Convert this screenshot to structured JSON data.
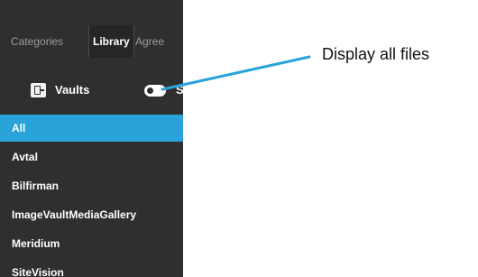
{
  "tabs": [
    {
      "label": "Categories",
      "active": false
    },
    {
      "label": "Library",
      "active": true
    },
    {
      "label": "Agree",
      "active": false
    }
  ],
  "vaults": {
    "label": "Vaults",
    "toggle_label": "S"
  },
  "library_items": [
    {
      "label": "All",
      "selected": true
    },
    {
      "label": "Avtal",
      "selected": false
    },
    {
      "label": "Bilfirman",
      "selected": false
    },
    {
      "label": "ImageVaultMediaGallery",
      "selected": false
    },
    {
      "label": "Meridium",
      "selected": false
    },
    {
      "label": "SiteVision",
      "selected": false
    }
  ],
  "callout": {
    "text": "Display all files"
  },
  "colors": {
    "panel_bg": "#2f2f30",
    "selected_bg": "#29a3da",
    "pointer_line": "#29a3da"
  }
}
